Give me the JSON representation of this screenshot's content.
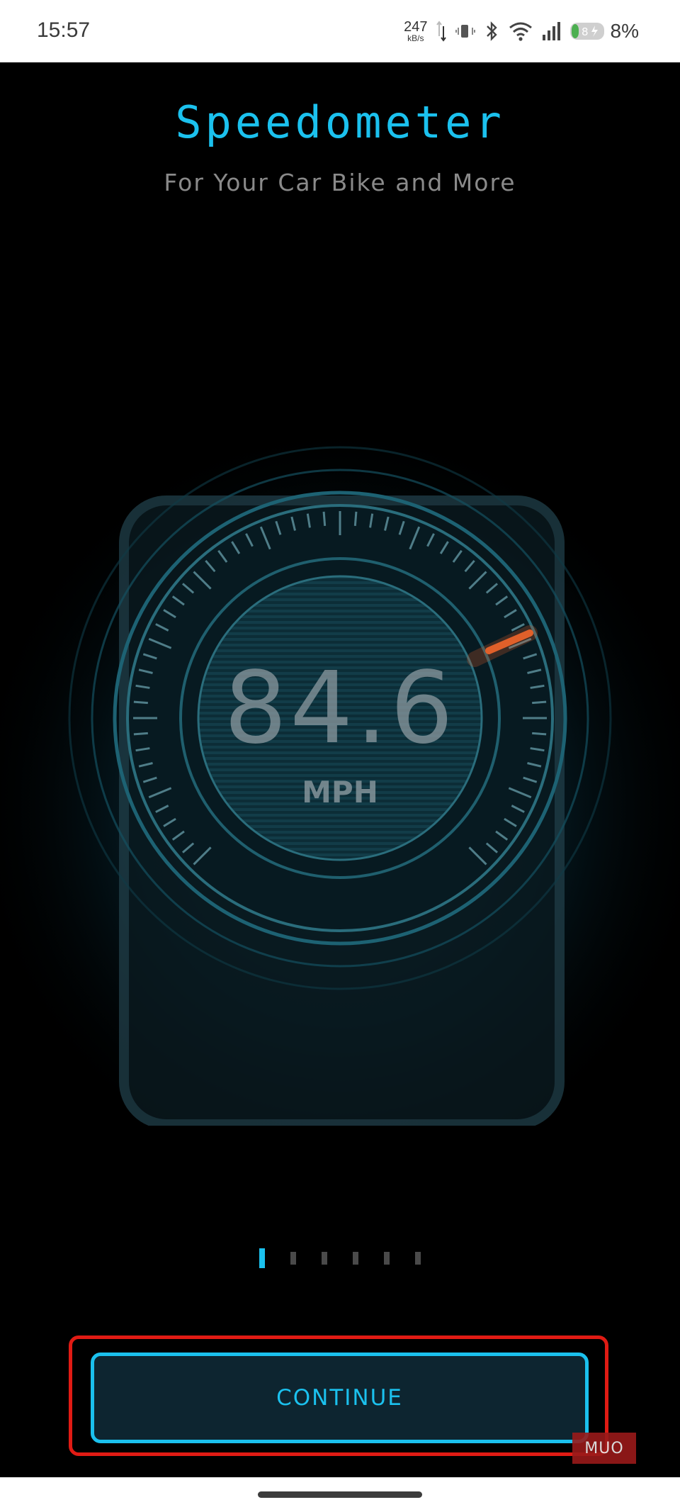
{
  "status_bar": {
    "time": "15:57",
    "net_speed_value": "247",
    "net_speed_unit": "kB/s",
    "battery_icon_level": "8",
    "battery_percent": "8%"
  },
  "header": {
    "title": "Speedometer",
    "subtitle": "For Your Car Bike and More"
  },
  "gauge": {
    "value": "84.6",
    "unit": "MPH"
  },
  "pager": {
    "total": 6,
    "active_index": 0
  },
  "actions": {
    "continue_label": "CONTINUE"
  },
  "watermark": {
    "text": "MUO"
  },
  "colors": {
    "accent": "#1bc1ee",
    "highlight": "#e01b14",
    "button_bg": "#0d2530",
    "gauge_ring": "#2a6d7c",
    "needle": "#e0602a"
  }
}
